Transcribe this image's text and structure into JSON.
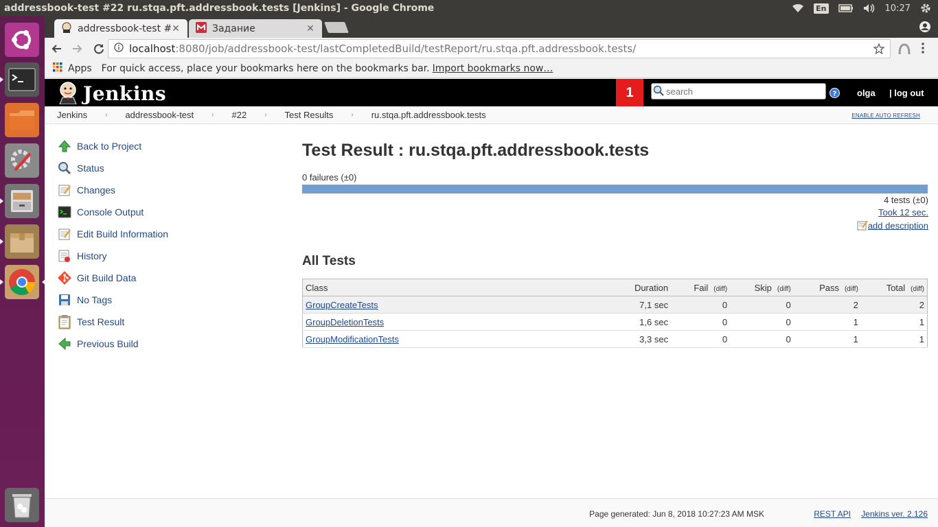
{
  "os": {
    "window_title": "addressbook-test #22 ru.stqa.pft.addressbook.tests [Jenkins] - Google Chrome",
    "keyboard_lang": "En",
    "clock": "10:27"
  },
  "browser": {
    "tabs": [
      {
        "label": "addressbook-test #",
        "active": true
      },
      {
        "label": "Задание",
        "active": false
      }
    ],
    "url_host": "localhost",
    "url_rest": ":8080/job/addressbook-test/lastCompletedBuild/testReport/ru.stqa.pft.addressbook.tests/",
    "bookmarks": {
      "apps_label": "Apps",
      "hint": "For quick access, place your bookmarks here on the bookmarks bar.",
      "import_label": "Import bookmarks now…"
    }
  },
  "jenkins": {
    "logo_text": "Jenkins",
    "notification_count": "1",
    "search_placeholder": "search",
    "user": "olga",
    "logout": "| log out",
    "breadcrumbs": [
      "Jenkins",
      "addressbook-test",
      "#22",
      "Test Results",
      "ru.stqa.pft.addressbook.tests"
    ],
    "auto_refresh": "ENABLE AUTO REFRESH",
    "tasks": [
      {
        "label": "Back to Project",
        "icon": "up-arrow-icon"
      },
      {
        "label": "Status",
        "icon": "magnifier-icon"
      },
      {
        "label": "Changes",
        "icon": "notepad-icon"
      },
      {
        "label": "Console Output",
        "icon": "terminal-icon"
      },
      {
        "label": "Edit Build Information",
        "icon": "notepad-icon"
      },
      {
        "label": "History",
        "icon": "history-icon"
      },
      {
        "label": "Git Build Data",
        "icon": "git-icon"
      },
      {
        "label": "No Tags",
        "icon": "save-icon"
      },
      {
        "label": "Test Result",
        "icon": "clipboard-icon"
      },
      {
        "label": "Previous Build",
        "icon": "left-arrow-icon"
      }
    ],
    "main": {
      "title": "Test Result : ru.stqa.pft.addressbook.tests",
      "failures": "0 failures (±0)",
      "fail_fraction": 0,
      "tests_count": "4 tests (±0)",
      "took": "Took 12 sec.",
      "add_description": "add description",
      "all_tests": "All Tests",
      "columns": {
        "class": "Class",
        "duration": "Duration",
        "fail": "Fail",
        "skip": "Skip",
        "pass": "Pass",
        "total": "Total",
        "diff": "(diff)"
      },
      "rows": [
        {
          "class": "GroupCreateTests",
          "duration": "7,1 sec",
          "fail": "0",
          "skip": "0",
          "pass": "2",
          "total": "2"
        },
        {
          "class": "GroupDeletionTests",
          "duration": "1,6 sec",
          "fail": "0",
          "skip": "0",
          "pass": "1",
          "total": "1"
        },
        {
          "class": "GroupModificationTests",
          "duration": "3,3 sec",
          "fail": "0",
          "skip": "0",
          "pass": "1",
          "total": "1"
        }
      ]
    },
    "footer": {
      "generated": "Page generated: Jun 8, 2018 10:27:23 AM MSK",
      "rest_api": "REST API",
      "version": "Jenkins ver. 2.126"
    }
  },
  "colors": {
    "jenkins_header": "#000000",
    "notification": "#e51c1c",
    "progress_pass": "#729fcf",
    "link": "#204a87",
    "launcher": "#6b1f57"
  }
}
